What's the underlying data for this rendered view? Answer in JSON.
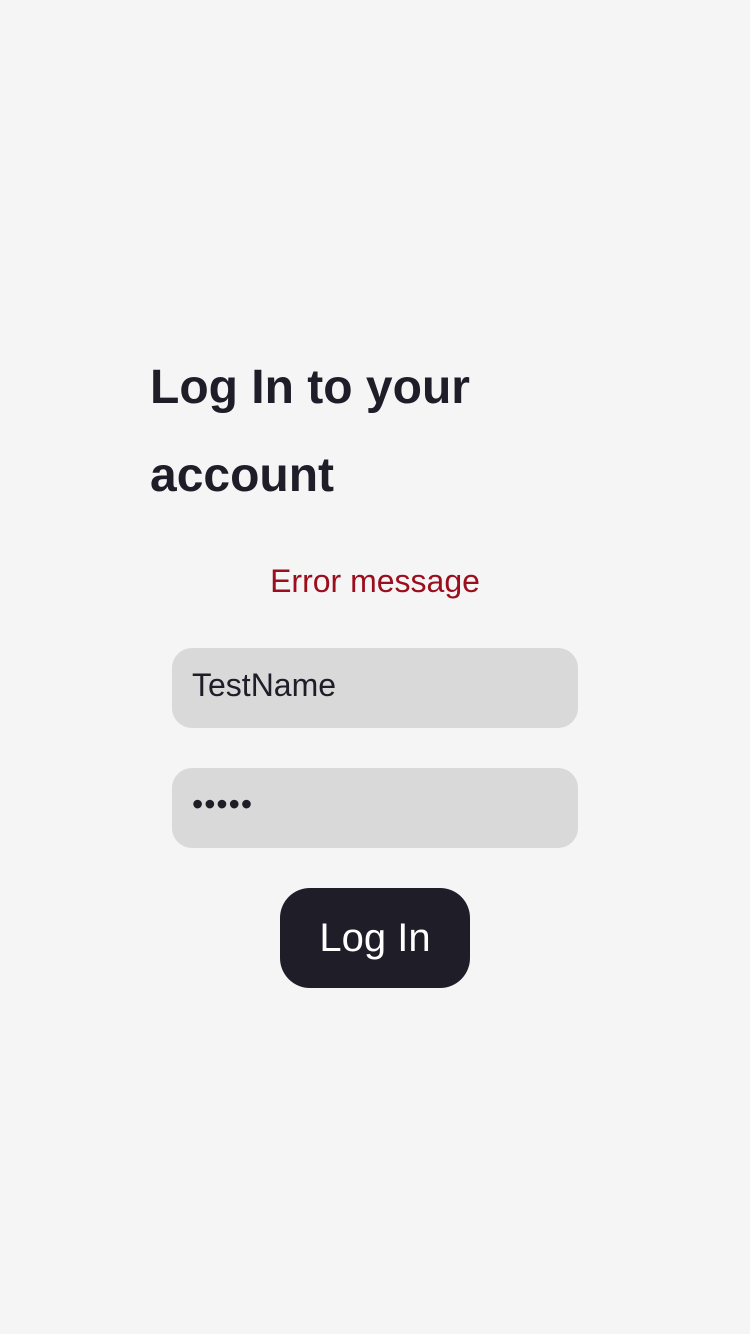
{
  "login": {
    "title": "Log In to your account",
    "error_message": "Error message",
    "username_value": "TestName",
    "password_value": "•••••",
    "submit_label": "Log In"
  },
  "colors": {
    "background": "#f5f5f5",
    "text_dark": "#1e1d28",
    "error_red": "#9b0e1e",
    "field_bg": "#d9d9d9",
    "button_bg": "#1e1d28",
    "button_text": "#ffffff"
  }
}
